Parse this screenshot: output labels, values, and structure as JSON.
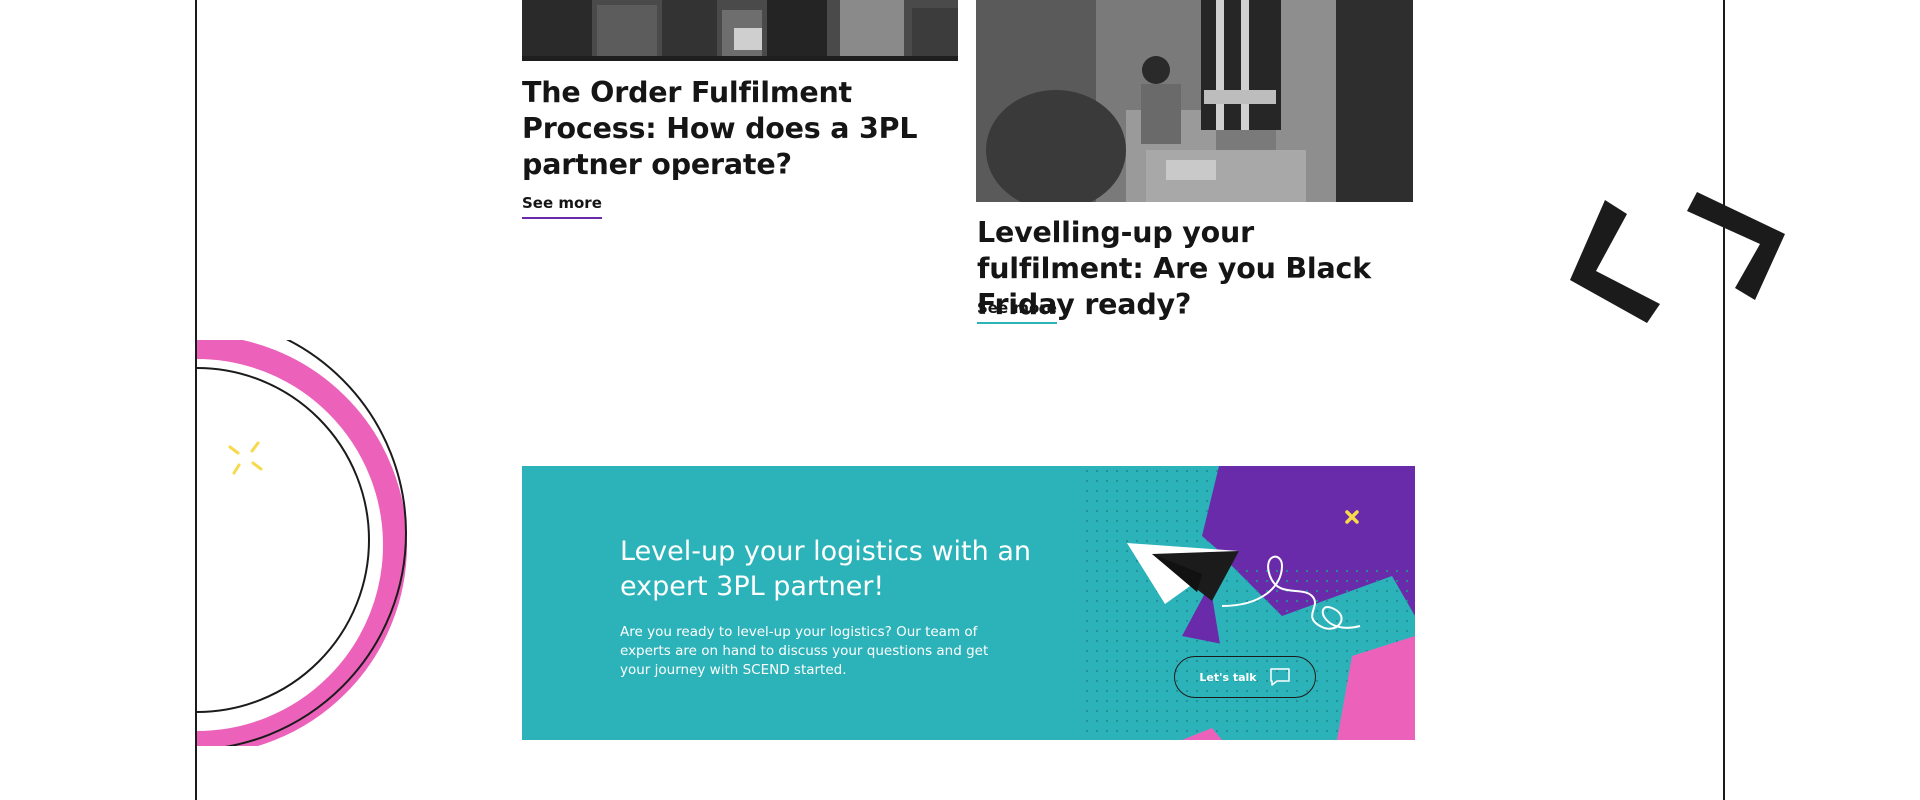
{
  "articles": [
    {
      "title": "The Order Fulfilment Process: How does a 3PL partner operate?",
      "link_label": "See more",
      "image_alt": "Warehouse shelving with parcels"
    },
    {
      "title": "Levelling-up your fulfilment: Are you Black Friday ready?",
      "link_label": "See more",
      "image_alt": "Warehouse workers packing orders"
    }
  ],
  "cta": {
    "heading": "Level-up your logistics with an expert 3PL partner!",
    "body": "Are you ready to level-up your logistics? Our team of experts are on hand to discuss your questions and get your journey with SCEND started.",
    "button_label": "Let's talk"
  },
  "colors": {
    "teal": "#2cb3b9",
    "purple": "#6a2bab",
    "pink": "#ec62bb",
    "yellow": "#f7d94c",
    "ink": "#1b1b1b"
  },
  "icons": [
    "chat-bubble-icon",
    "paper-plane-icon",
    "sparkle-icon",
    "close-x-icon",
    "chevron-brackets-icon"
  ]
}
